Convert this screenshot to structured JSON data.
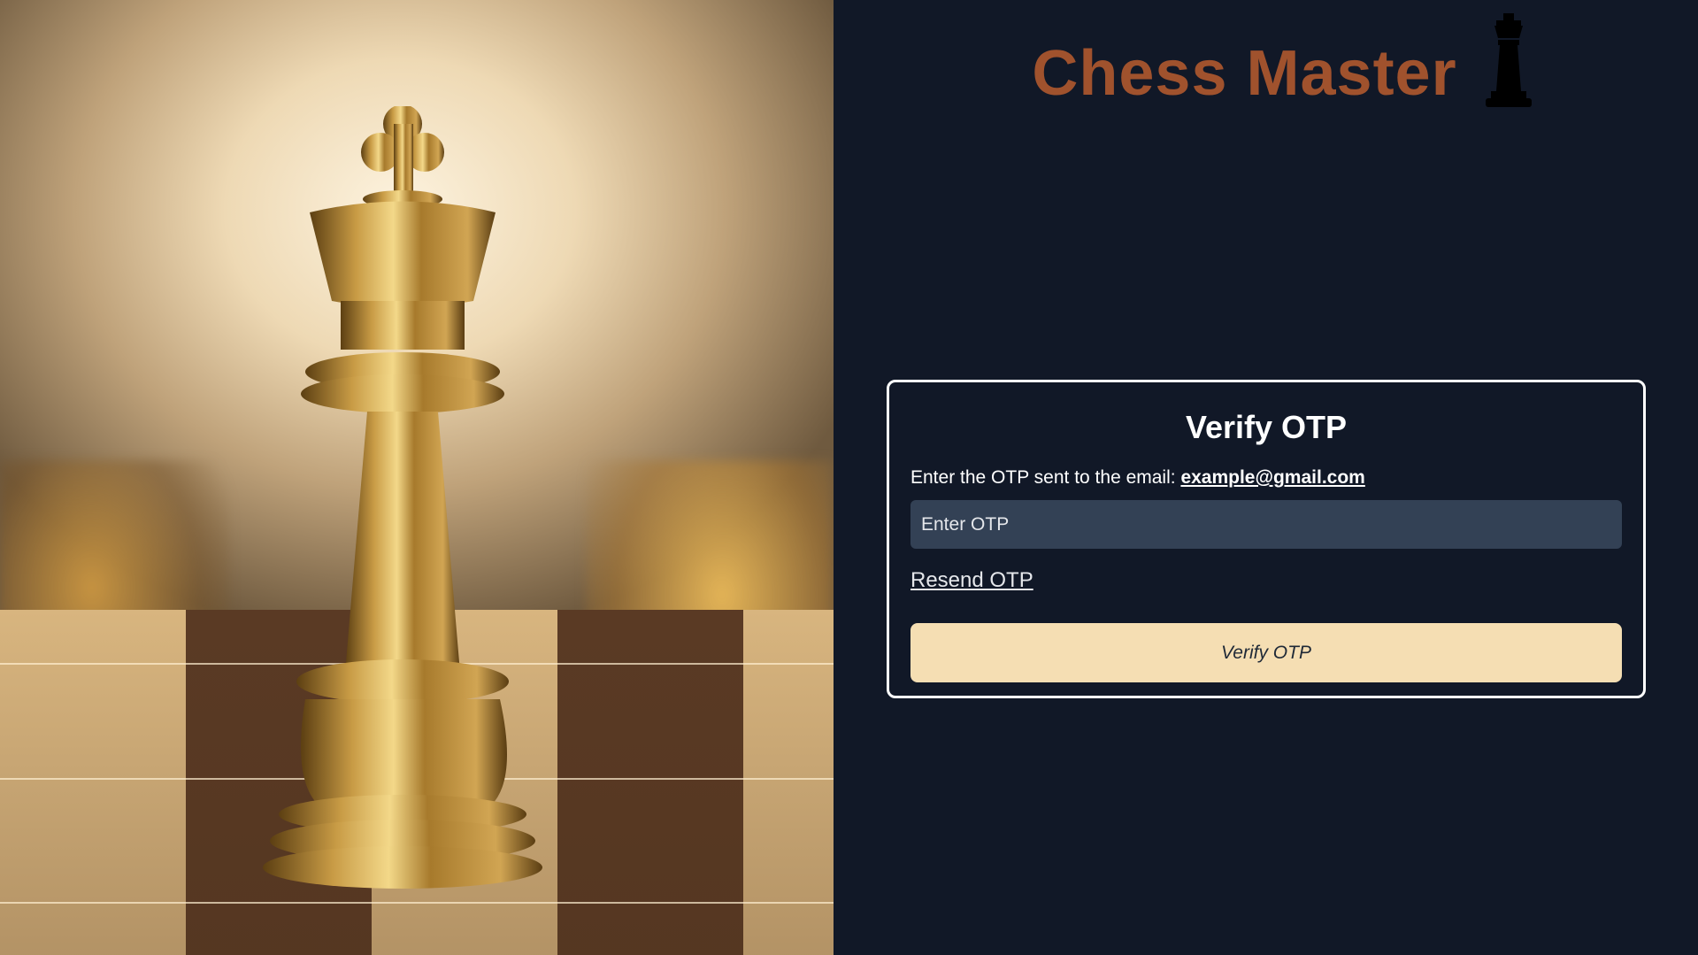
{
  "brand": {
    "title": "Chess Master",
    "icon": "chess-rook-icon",
    "color": "#a0522d"
  },
  "hero": {
    "image": "golden-chess-king-photo"
  },
  "verify_card": {
    "title": "Verify OTP",
    "message_prefix": "Enter the OTP sent to the email: ",
    "email": "example@gmail.com",
    "otp_input": {
      "placeholder": "Enter OTP",
      "value": ""
    },
    "resend_label": "Resend OTP",
    "verify_button_label": "Verify OTP"
  },
  "colors": {
    "background": "#111827",
    "input_background": "#334155",
    "button_background": "#f5deb3",
    "card_border": "#ffffff"
  }
}
